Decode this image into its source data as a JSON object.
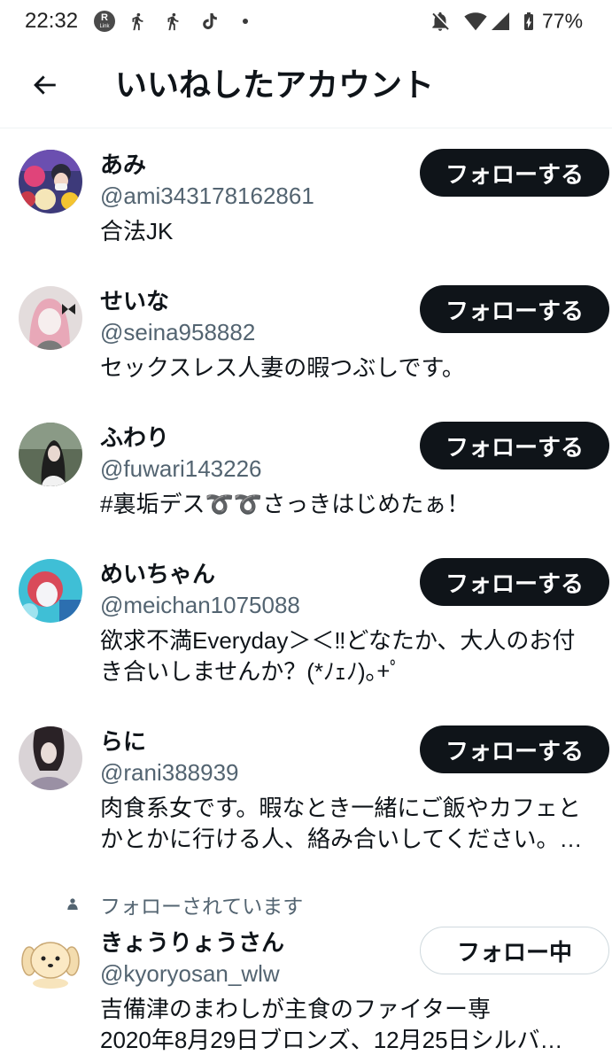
{
  "status_bar": {
    "time": "22:32",
    "badge": {
      "top": "R",
      "bottom": "Link"
    },
    "battery_percent": "77%",
    "icons": [
      "r-link-badge",
      "walking-person-icon",
      "walking-person-icon",
      "tiktok-icon",
      "notification-dot-icon",
      "bell-off-icon",
      "wifi-icon",
      "signal-icon",
      "battery-charging-icon"
    ]
  },
  "header": {
    "back_icon": "arrow-left-icon",
    "title": "いいねしたアカウント"
  },
  "colors": {
    "background": "#ffffff",
    "text": "#0f1419",
    "secondary_text": "#536471",
    "follow_button_bg": "#0f1419",
    "follow_button_text": "#ffffff",
    "following_button_border": "#cfd9de",
    "divider": "#eff3f4"
  },
  "users": [
    {
      "name": "あみ",
      "handle": "@ami343178162861",
      "bio_lines": [
        "合法JK"
      ],
      "button": "フォローする",
      "following": false
    },
    {
      "name": "せいな",
      "handle": "@seina958882",
      "bio_lines": [
        "セックスレス人妻の暇つぶしです。"
      ],
      "button": "フォローする",
      "following": false
    },
    {
      "name": "ふわり",
      "handle": "@fuwari143226",
      "bio_lines": [
        "#裏垢デス➰➰さっきはじめたぁ！"
      ],
      "button": "フォローする",
      "following": false
    },
    {
      "name": "めいちゃん",
      "handle": "@meichan1075088",
      "bio_lines": [
        "欲求不満Everyday＞＜‼どなたか、大人のお付",
        "き合いしませんか？(*ﾉｪﾉ)｡+ﾟ"
      ],
      "button": "フォローする",
      "following": false
    },
    {
      "name": "らに",
      "handle": "@rani388939",
      "bio_lines": [
        "肉食系女です。暇なとき一緒にご飯やカフェと",
        "かとかに行ける人、絡み合いしてください。…"
      ],
      "button": "フォローする",
      "following": false
    },
    {
      "social_context": "フォローされています",
      "social_icon": "person-icon",
      "name": "きょうりょうさん",
      "handle": "@kyoryosan_wlw",
      "bio_lines": [
        "吉備津のまわしが主食のファイター専",
        "2020年8月29日ブロンズ、12月25日シルバ…"
      ],
      "button": "フォロー中",
      "following": true
    }
  ]
}
